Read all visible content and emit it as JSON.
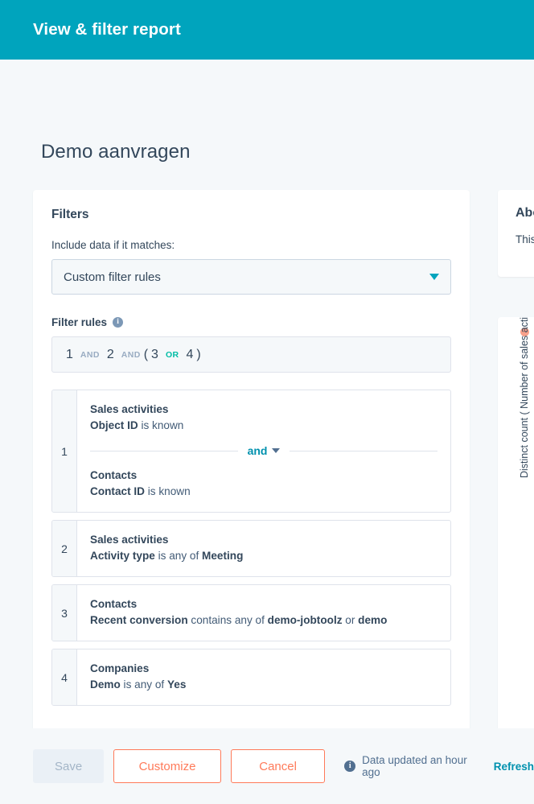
{
  "header": {
    "title": "View & filter report"
  },
  "page": {
    "title": "Demo aanvragen"
  },
  "filters": {
    "section_title": "Filters",
    "include_label": "Include data if it matches:",
    "match_select": {
      "value": "Custom filter rules",
      "caret_icon": "chevron-down-icon"
    },
    "rules_label": "Filter rules",
    "info_icon": "info-icon",
    "info_glyph": "i",
    "expression": {
      "parts": [
        {
          "type": "num",
          "text": "1"
        },
        {
          "type": "and",
          "text": "AND"
        },
        {
          "type": "num",
          "text": "2"
        },
        {
          "type": "and",
          "text": "AND"
        },
        {
          "type": "paren",
          "text": "("
        },
        {
          "type": "num",
          "text": "3"
        },
        {
          "type": "or",
          "text": "OR"
        },
        {
          "type": "num",
          "text": "4"
        },
        {
          "type": "paren",
          "text": ")"
        }
      ]
    },
    "rules": [
      {
        "index": "1",
        "conditions": [
          {
            "object": "Sales activities",
            "property": "Object ID",
            "operator": " is known",
            "value": ""
          },
          {
            "object": "Contacts",
            "property": "Contact ID",
            "operator": " is known",
            "value": ""
          }
        ],
        "joiner": "and"
      },
      {
        "index": "2",
        "conditions": [
          {
            "object": "Sales activities",
            "property": "Activity type",
            "operator": " is any of ",
            "value": "Meeting"
          }
        ]
      },
      {
        "index": "3",
        "conditions": [
          {
            "object": "Contacts",
            "property": "Recent conversion",
            "operator": " contains any of ",
            "value": "demo-jobtoolz",
            "operator2": " or ",
            "value2": "demo"
          }
        ]
      },
      {
        "index": "4",
        "conditions": [
          {
            "object": "Companies",
            "property": "Demo",
            "operator": " is any of ",
            "value": "Yes"
          }
        ]
      }
    ]
  },
  "side_panel": {
    "about_title": "About this report",
    "about_text": "This report shows",
    "legend_dot_icon": "legend-dot-icon",
    "y_axis_label": "Distinct count ( Number of sales activities )"
  },
  "footer": {
    "save_label": "Save",
    "customize_label": "Customize",
    "cancel_label": "Cancel",
    "status_icon": "info-icon",
    "status_glyph": "i",
    "status_text": "Data updated an hour ago",
    "refresh_label": "Refresh"
  },
  "colors": {
    "header_teal": "#00A4BD",
    "link_teal": "#0091AE",
    "accent_orange": "#FF7A59",
    "or_green": "#00BDA5",
    "dot_salmon": "#F8A18B",
    "text_dark": "#33475B",
    "page_bg": "#F5F8FA"
  }
}
